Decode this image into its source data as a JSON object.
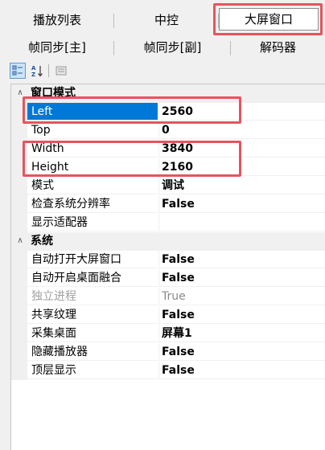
{
  "tabs_row1": [
    {
      "label": "播放列表"
    },
    {
      "label": "中控"
    },
    {
      "label": "大屏窗口",
      "active": true
    }
  ],
  "tabs_row2": [
    {
      "label": "帧同步[主]"
    },
    {
      "label": "帧同步[副]"
    },
    {
      "label": "解码器"
    }
  ],
  "toolbar": {
    "categorized_icon": "categorized-view-icon",
    "alphabetical_icon": "alphabetical-sort-icon",
    "pages_icon": "property-pages-icon"
  },
  "grid": {
    "category1": {
      "name": "窗口模式"
    },
    "props1": [
      {
        "name": "Left",
        "value": "2560",
        "selected": true
      },
      {
        "name": "Top",
        "value": "0"
      },
      {
        "name": "Width",
        "value": "3840"
      },
      {
        "name": "Height",
        "value": "2160"
      },
      {
        "name": "模式",
        "value": "调试"
      },
      {
        "name": "检查系统分辨率",
        "value": "False"
      },
      {
        "name": "显示适配器",
        "value": ""
      }
    ],
    "category2": {
      "name": "系统"
    },
    "props2": [
      {
        "name": "自动打开大屏窗口",
        "value": "False"
      },
      {
        "name": "自动开启桌面融合",
        "value": "False"
      },
      {
        "name": "独立进程",
        "value": "True",
        "disabled": true
      },
      {
        "name": "共享纹理",
        "value": "False"
      },
      {
        "name": "采集桌面",
        "value": "屏幕1"
      },
      {
        "name": "隐藏播放器",
        "value": "False"
      },
      {
        "name": "顶层显示",
        "value": "False"
      }
    ]
  },
  "colors": {
    "highlight": "#e8535d",
    "selection": "#0078d7"
  }
}
